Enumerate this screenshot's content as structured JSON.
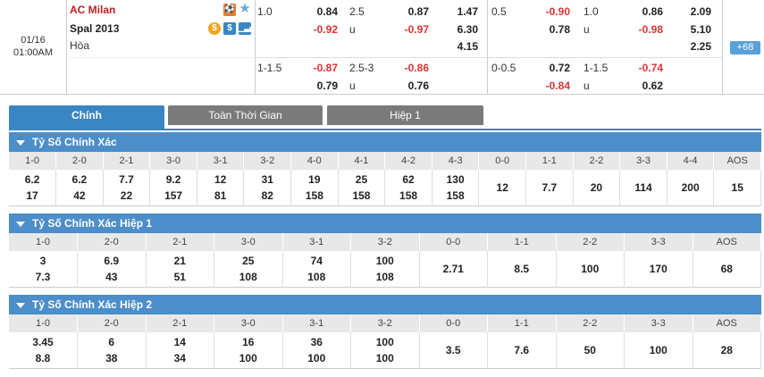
{
  "match": {
    "date": "01/16",
    "time": "01:00AM",
    "home": "AC Milan",
    "away": "Spal 2013",
    "draw": "Hòa",
    "more_count": "68"
  },
  "odds": {
    "row1": {
      "hcp_line": "1.0",
      "hcp_home": "0.84",
      "hcp_away": "-0.92",
      "ou_line": "2.5",
      "ou_over": "0.87",
      "ou_u": "u",
      "ou_under": "-0.97",
      "x12_home": "1.47",
      "x12_away": "6.30",
      "x12_draw": "4.15",
      "h1_hcp_line": "0.5",
      "h1_hcp_home": "-0.90",
      "h1_hcp_away": "0.78",
      "h1_ou_line": "1.0",
      "h1_ou_over": "0.86",
      "h1_ou_u": "u",
      "h1_ou_under": "-0.98",
      "h1_x12_home": "2.09",
      "h1_x12_away": "5.10",
      "h1_x12_draw": "2.25"
    },
    "row2": {
      "hcp_line": "1-1.5",
      "hcp_home": "-0.87",
      "hcp_away": "0.79",
      "ou_line": "2.5-3",
      "ou_over": "-0.86",
      "ou_u": "u",
      "ou_under": "0.76",
      "h1_hcp_line": "0-0.5",
      "h1_hcp_home": "0.72",
      "h1_hcp_away": "-0.84",
      "h1_ou_line": "1-1.5",
      "h1_ou_over": "-0.74",
      "h1_ou_u": "u",
      "h1_ou_under": "0.62"
    }
  },
  "tabs": [
    "Chính",
    "Toàn Thời Gian",
    "Hiệp 1"
  ],
  "sections": [
    {
      "title": "Tỷ Số Chính Xác",
      "headers": [
        "1-0",
        "2-0",
        "2-1",
        "3-0",
        "3-1",
        "3-2",
        "4-0",
        "4-1",
        "4-2",
        "4-3",
        "0-0",
        "1-1",
        "2-2",
        "3-3",
        "4-4",
        "AOS"
      ],
      "line1": [
        "6.2",
        "6.2",
        "7.7",
        "9.2",
        "12",
        "31",
        "19",
        "25",
        "62",
        "130",
        "12",
        "7.7",
        "20",
        "114",
        "200",
        "15"
      ],
      "line2": [
        "17",
        "42",
        "22",
        "157",
        "81",
        "82",
        "158",
        "158",
        "158",
        "158",
        "",
        "",
        "",
        "",
        "",
        ""
      ]
    },
    {
      "title": "Tỷ Số Chính Xác Hiệp 1",
      "headers": [
        "1-0",
        "2-0",
        "2-1",
        "3-0",
        "3-1",
        "3-2",
        "0-0",
        "1-1",
        "2-2",
        "3-3",
        "AOS"
      ],
      "line1": [
        "3",
        "6.9",
        "21",
        "25",
        "74",
        "100",
        "2.71",
        "8.5",
        "100",
        "170",
        "68"
      ],
      "line2": [
        "7.3",
        "43",
        "51",
        "108",
        "108",
        "108",
        "",
        "",
        "",
        "",
        ""
      ]
    },
    {
      "title": "Tỷ Số Chính Xác Hiệp 2",
      "headers": [
        "1-0",
        "2-0",
        "2-1",
        "3-0",
        "3-1",
        "3-2",
        "0-0",
        "1-1",
        "2-2",
        "3-3",
        "AOS"
      ],
      "line1": [
        "3.45",
        "6",
        "14",
        "16",
        "36",
        "100",
        "3.5",
        "7.6",
        "50",
        "100",
        "28"
      ],
      "line2": [
        "8.8",
        "38",
        "34",
        "100",
        "100",
        "100",
        "",
        "",
        "",
        "",
        ""
      ]
    }
  ],
  "colors": {
    "header_blue": "#4c8ec9",
    "tab_gray": "#7a7a7a",
    "odds_red": "#d33",
    "home_red": "#b22"
  }
}
